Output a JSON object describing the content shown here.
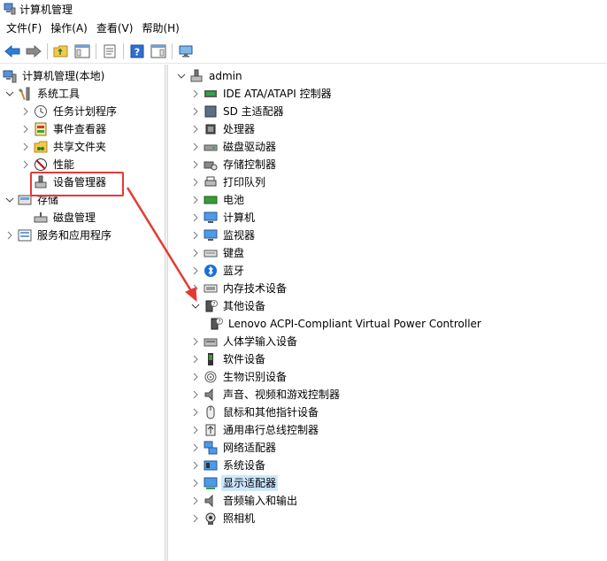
{
  "window": {
    "title": "计算机管理"
  },
  "menu": [
    {
      "label": "文件(F)"
    },
    {
      "label": "操作(A)"
    },
    {
      "label": "查看(V)"
    },
    {
      "label": "帮助(H)"
    }
  ],
  "toolbar": {
    "icons": [
      "back-arrow-icon",
      "forward-arrow-icon",
      "up-folder-icon",
      "show-hide-tree-icon",
      "properties-icon",
      "help-icon",
      "action-pane-icon",
      "monitor-icon"
    ]
  },
  "left_tree": {
    "root": "计算机管理(本地)",
    "system_tools": "系统工具",
    "task_scheduler": "任务计划程序",
    "event_viewer": "事件查看器",
    "shared_folders": "共享文件夹",
    "performance": "性能",
    "device_manager": "设备管理器",
    "storage": "存储",
    "disk_management": "磁盘管理",
    "services_apps": "服务和应用程序"
  },
  "right_tree": {
    "root": "admin",
    "items": [
      {
        "label": "IDE ATA/ATAPI 控制器",
        "icon": "ide-controller-icon"
      },
      {
        "label": "SD 主适配器",
        "icon": "sd-host-icon"
      },
      {
        "label": "处理器",
        "icon": "processor-icon"
      },
      {
        "label": "磁盘驱动器",
        "icon": "disk-drive-icon"
      },
      {
        "label": "存储控制器",
        "icon": "storage-controller-icon"
      },
      {
        "label": "打印队列",
        "icon": "printer-icon"
      },
      {
        "label": "电池",
        "icon": "battery-icon"
      },
      {
        "label": "计算机",
        "icon": "computer-icon"
      },
      {
        "label": "监视器",
        "icon": "monitor-icon"
      },
      {
        "label": "键盘",
        "icon": "keyboard-icon"
      },
      {
        "label": "蓝牙",
        "icon": "bluetooth-icon"
      },
      {
        "label": "内存技术设备",
        "icon": "memory-icon"
      },
      {
        "label": "其他设备",
        "icon": "unknown-device-icon"
      },
      {
        "label": "Lenovo ACPI-Compliant Virtual Power Controller",
        "icon": "unknown-device-icon"
      },
      {
        "label": "人体学输入设备",
        "icon": "hid-icon"
      },
      {
        "label": "软件设备",
        "icon": "software-device-icon"
      },
      {
        "label": "生物识别设备",
        "icon": "fingerprint-icon"
      },
      {
        "label": "声音、视频和游戏控制器",
        "icon": "speaker-icon"
      },
      {
        "label": "鼠标和其他指针设备",
        "icon": "mouse-icon"
      },
      {
        "label": "通用串行总线控制器",
        "icon": "usb-icon"
      },
      {
        "label": "网络适配器",
        "icon": "network-icon"
      },
      {
        "label": "系统设备",
        "icon": "system-device-icon"
      },
      {
        "label": "显示适配器",
        "icon": "display-adapter-icon"
      },
      {
        "label": "音频输入和输出",
        "icon": "audio-io-icon"
      },
      {
        "label": "照相机",
        "icon": "camera-icon"
      }
    ]
  },
  "colors": {
    "selection": "#cce8ff",
    "annotation": "#e53935"
  }
}
